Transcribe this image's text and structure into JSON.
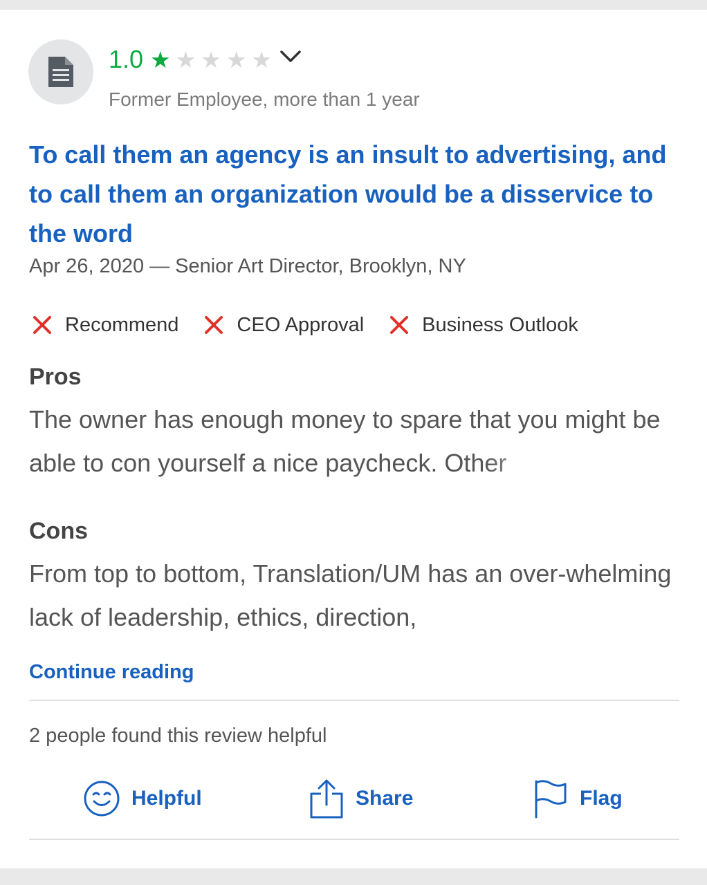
{
  "review": {
    "rating": "1.0",
    "stars_filled": 1,
    "stars_total": 5,
    "employee_status": "Former Employee, more than 1 year",
    "title": "To call them an agency is an insult to advertising, and to call them an organization would be a disservice to the word",
    "meta": "Apr 26, 2020 — Senior Art Director, Brooklyn, NY",
    "checks": [
      {
        "label": "Recommend",
        "status": "negative",
        "icon": "x-icon"
      },
      {
        "label": "CEO Approval",
        "status": "negative",
        "icon": "x-icon"
      },
      {
        "label": "Business Outlook",
        "status": "negative",
        "icon": "x-icon"
      }
    ],
    "pros_heading": "Pros",
    "pros_text": "The owner has enough money to spare that you might be able to con yourself a nice paycheck. Other",
    "cons_heading": "Cons",
    "cons_text": "From top to bottom, Translation/UM has an over-whelming lack of leadership, ethics, direction,",
    "continue_label": "Continue reading",
    "helpful_count_text": "2 people found this review helpful"
  },
  "actions": {
    "helpful": {
      "label": "Helpful",
      "icon": "smiley-icon"
    },
    "share": {
      "label": "Share",
      "icon": "share-icon"
    },
    "flag": {
      "label": "Flag",
      "icon": "flag-icon"
    }
  },
  "colors": {
    "rating_green": "#0caa41",
    "link_blue": "#1861bf",
    "negative_red": "#e0302a"
  }
}
